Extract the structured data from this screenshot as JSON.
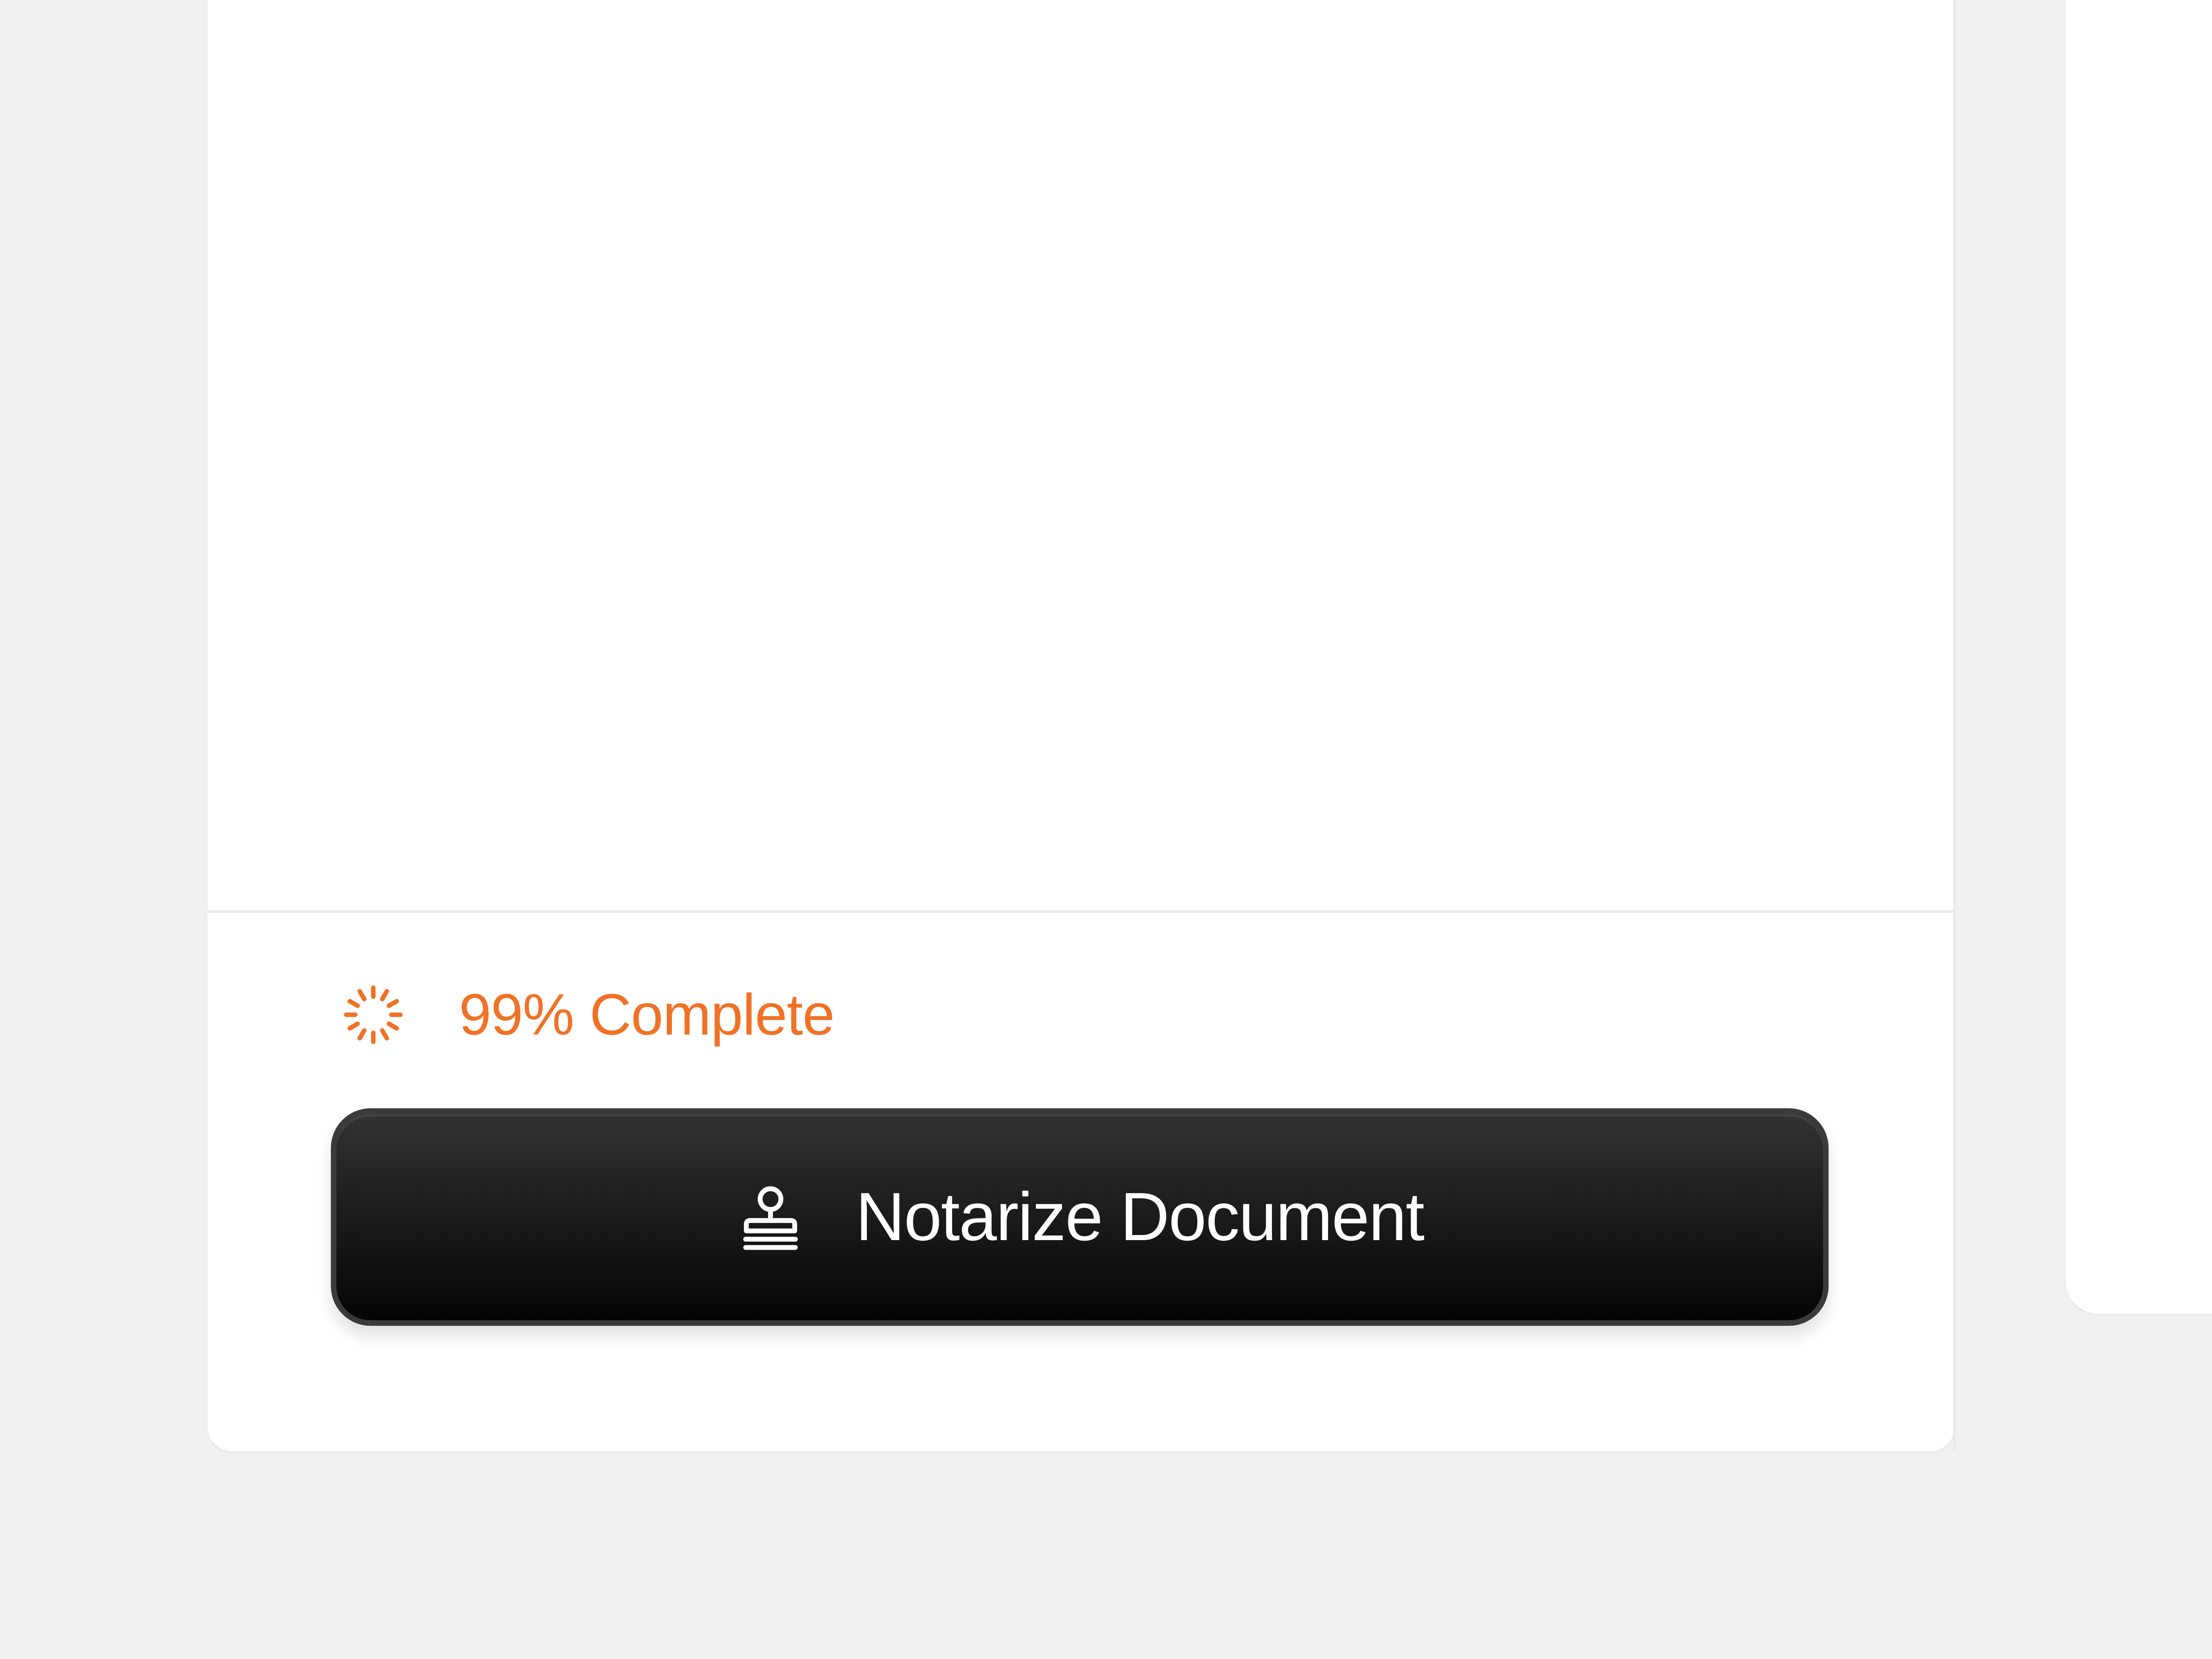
{
  "status": {
    "progress_percent": 99,
    "label": "99% Complete",
    "accent_color": "#f07226",
    "icon": "loading-spinner-icon"
  },
  "actions": {
    "notarize_label": "Notarize Document",
    "notarize_icon": "stamp-icon"
  },
  "colors": {
    "background": "#f2f1ef",
    "panel": "#ffffff",
    "button": "#111111",
    "button_text": "#ffffff"
  }
}
